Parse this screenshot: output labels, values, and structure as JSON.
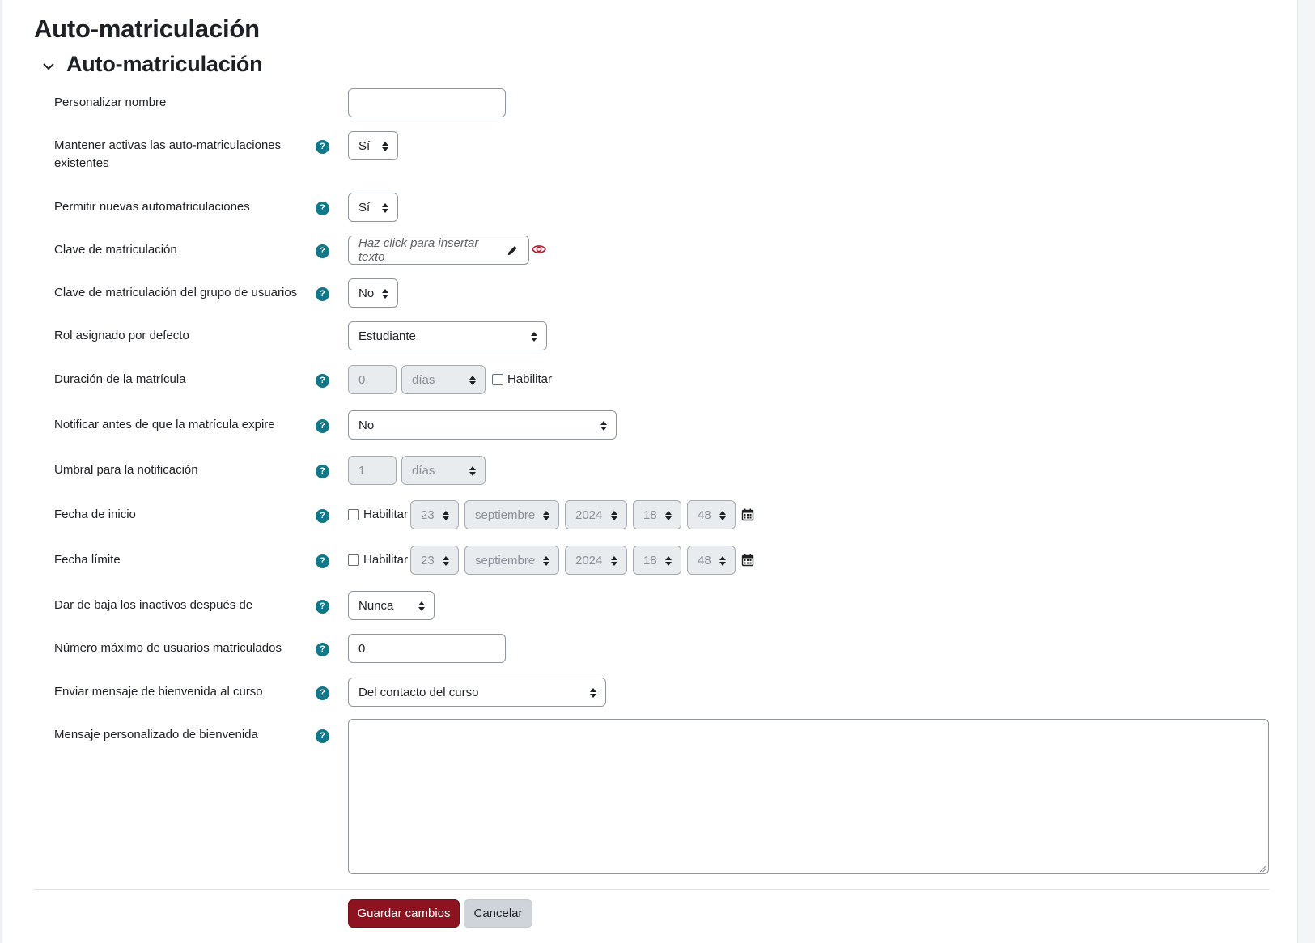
{
  "page": {
    "title": "Auto-matriculación"
  },
  "section": {
    "title": "Auto-matriculación"
  },
  "fields": {
    "custom_name": {
      "label": "Personalizar nombre",
      "value": ""
    },
    "keep_existing": {
      "label": "Mantener activas las auto-matriculaciones existentes",
      "value": "Sí"
    },
    "allow_new": {
      "label": "Permitir nuevas automatriculaciones",
      "value": "Sí"
    },
    "enrol_key": {
      "label": "Clave de matriculación",
      "placeholder": "Haz click para insertar texto"
    },
    "group_key": {
      "label": "Clave de matriculación del grupo de usuarios",
      "value": "No"
    },
    "default_role": {
      "label": "Rol asignado por defecto",
      "value": "Estudiante"
    },
    "duration": {
      "label": "Duración de la matrícula",
      "value": "0",
      "unit": "días",
      "enable_label": "Habilitar"
    },
    "notify_expiry": {
      "label": "Notificar antes de que la matrícula expire",
      "value": "No"
    },
    "notify_threshold": {
      "label": "Umbral para la notificación",
      "value": "1",
      "unit": "días"
    },
    "start_date": {
      "label": "Fecha de inicio",
      "enable_label": "Habilitar",
      "day": "23",
      "month": "septiembre",
      "year": "2024",
      "hour": "18",
      "minute": "48"
    },
    "end_date": {
      "label": "Fecha límite",
      "enable_label": "Habilitar",
      "day": "23",
      "month": "septiembre",
      "year": "2024",
      "hour": "18",
      "minute": "48"
    },
    "unenrol_inactive": {
      "label": "Dar de baja los inactivos después de",
      "value": "Nunca"
    },
    "max_enrolled": {
      "label": "Número máximo de usuarios matriculados",
      "value": "0"
    },
    "send_welcome": {
      "label": "Enviar mensaje de bienvenida al curso",
      "value": "Del contacto del curso"
    },
    "welcome_message": {
      "label": "Mensaje personalizado de bienvenida",
      "value": ""
    }
  },
  "help_icon_glyph": "?",
  "buttons": {
    "save": "Guardar cambios",
    "cancel": "Cancelar"
  },
  "colors": {
    "primary": "#8e1320",
    "help": "#117889",
    "reveal_icon": "#b3192a"
  }
}
